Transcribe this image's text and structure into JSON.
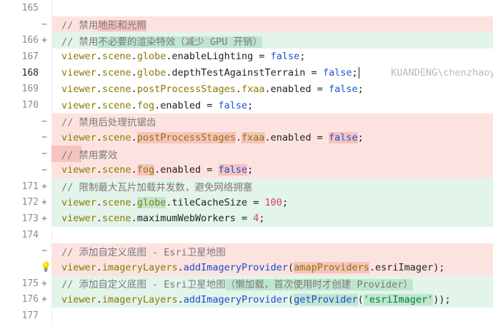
{
  "lines": [
    {
      "num": "165",
      "marker": "",
      "type": "ctx"
    },
    {
      "num": "",
      "marker": "−",
      "type": "del"
    },
    {
      "num": "166",
      "marker": "+",
      "type": "add"
    },
    {
      "num": "167",
      "marker": "",
      "type": "ctx"
    },
    {
      "num": "168",
      "marker": "",
      "type": "ctx"
    },
    {
      "num": "169",
      "marker": "",
      "type": "ctx"
    },
    {
      "num": "170",
      "marker": "",
      "type": "ctx"
    },
    {
      "num": "",
      "marker": "−",
      "type": "del"
    },
    {
      "num": "",
      "marker": "−",
      "type": "del"
    },
    {
      "num": "",
      "marker": "−",
      "type": "del"
    },
    {
      "num": "",
      "marker": "−",
      "type": "del"
    },
    {
      "num": "171",
      "marker": "+",
      "type": "add"
    },
    {
      "num": "172",
      "marker": "+",
      "type": "add"
    },
    {
      "num": "173",
      "marker": "+",
      "type": "add"
    },
    {
      "num": "174",
      "marker": "",
      "type": "ctx"
    },
    {
      "num": "",
      "marker": "−",
      "type": "del"
    },
    {
      "num": "",
      "marker": "bulb",
      "type": "del"
    },
    {
      "num": "175",
      "marker": "+",
      "type": "add"
    },
    {
      "num": "176",
      "marker": "+",
      "type": "add"
    },
    {
      "num": "177",
      "marker": "",
      "type": "ctx"
    }
  ],
  "code": {
    "l2_comment_prefix": "// 禁用",
    "l2_comment_hl": "地形和光照",
    "l3_comment_prefix": "// 禁用",
    "l3_comment_hl": "不必要的渲染特效（减少 GPU 开销）",
    "l4": {
      "viewer": "viewer",
      "scene": "scene",
      "globe": "globe",
      "prop": "enableLighting",
      "eq": " = ",
      "val": "false",
      "end": ";"
    },
    "l5": {
      "viewer": "viewer",
      "scene": "scene",
      "globe": "globe",
      "prop": "depthTestAgainstTerrain",
      "eq": " = ",
      "val": "false",
      "end": ";"
    },
    "l5_blame": "KUANDENG\\chenzhaoyi",
    "l6": {
      "viewer": "viewer",
      "scene": "scene",
      "pps": "postProcessStages",
      "fxaa": "fxaa",
      "enabled": "enabled",
      "eq": " = ",
      "val": "false",
      "end": ";"
    },
    "l7": {
      "viewer": "viewer",
      "scene": "scene",
      "fog": "fog",
      "enabled": "enabled",
      "eq": " = ",
      "val": "false",
      "end": ";"
    },
    "l8_comment": "// 禁用后处理抗锯齿",
    "l9": {
      "viewer": "viewer",
      "scene": "scene",
      "pps": "postProcessStages",
      "fxaa": "fxaa",
      "enabled": "enabled",
      "eq": " = ",
      "val": "false",
      "end": ";"
    },
    "l10_comment": "// 禁用雾效",
    "l11": {
      "viewer": "viewer",
      "scene": "scene",
      "fog": "fog",
      "enabled": "enabled",
      "eq": " = ",
      "val": "false",
      "end": ";"
    },
    "l12_comment": "// 限制最大瓦片加载并发数，避免网络拥塞",
    "l13": {
      "viewer": "viewer",
      "scene": "scene",
      "globe": "globe",
      "prop": "tileCacheSize",
      "eq": " = ",
      "val": "100",
      "end": ";"
    },
    "l14": {
      "viewer": "viewer",
      "scene": "scene",
      "prop": "maximumWebWorkers",
      "eq": " = ",
      "val": "4",
      "end": ";"
    },
    "l16_comment": "// 添加自定义底图 - Esri卫星地图",
    "l17": {
      "viewer": "viewer",
      "layers": "imageryLayers",
      "fn": "addImageryProvider",
      "arg": "amapProviders",
      "arg2": "esriImager",
      "end": ");"
    },
    "l18_comment_prefix": "// 添加自定义底图 - Esri卫星地图",
    "l18_comment_hl": "（懒加载，首次使用时才创建 Provider）",
    "l19": {
      "viewer": "viewer",
      "layers": "imageryLayers",
      "fn": "addImageryProvider",
      "fn2": "getProvider",
      "str": "'esriImager'",
      "end": "));"
    }
  }
}
